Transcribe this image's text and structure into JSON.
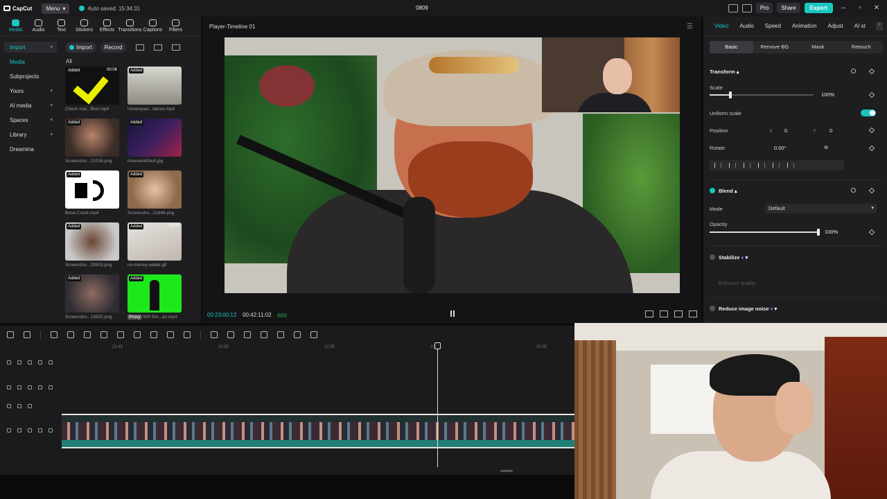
{
  "titlebar": {
    "app_name": "CapCut",
    "menu_label": "Menu",
    "autosave": "Auto saved: 15:34:31",
    "project_title": "0809",
    "pro_label": "Pro",
    "share_label": "Share",
    "export_label": "Export"
  },
  "tool_tabs": [
    "Media",
    "Audio",
    "Text",
    "Stickers",
    "Effects",
    "Transitions",
    "Captions",
    "Filters"
  ],
  "sidebar": [
    "Import",
    "Media",
    "Subprojects",
    "Yours",
    "AI media",
    "Spaces",
    "Library",
    "Dreamina"
  ],
  "media_toolbar": {
    "import": "Import",
    "record": "Record"
  },
  "media_filter": "All",
  "media_items": [
    {
      "name": "Check mar...ffect.mp4",
      "badge": "Added",
      "duration": "00:06"
    },
    {
      "name": "ishowspee...dance.mp4",
      "badge": "Added",
      "duration": ""
    },
    {
      "name": "Screensho...21028.png",
      "badge": "Added",
      "duration": ""
    },
    {
      "name": "maxresdefault.jpg",
      "badge": "Added",
      "duration": ""
    },
    {
      "name": "Bone Crack.mp4",
      "badge": "Added",
      "duration": ""
    },
    {
      "name": "Screensho...21646.png",
      "badge": "Added",
      "duration": ""
    },
    {
      "name": "Screensho...23503.png",
      "badge": "Added",
      "duration": ""
    },
    {
      "name": "no-money-wallet.gif",
      "badge": "Added",
      "duration": "00:05"
    },
    {
      "name": "Screensho...13825.png",
      "badge": "Added",
      "duration": ""
    },
    {
      "name": "Will Sm...an.mp4",
      "badge": "Added",
      "duration": "",
      "proxy": "Proxy"
    }
  ],
  "player": {
    "title": "Player-Timeline 01",
    "current_time": "00:23:00:12",
    "total_time": "00:42:11:02"
  },
  "props": {
    "tabs": [
      "Video",
      "Audio",
      "Speed",
      "Animation",
      "Adjust",
      "AI st"
    ],
    "subtabs": [
      "Basic",
      "Remove BG",
      "Mask",
      "Retouch"
    ],
    "transform_label": "Transform",
    "scale_label": "Scale",
    "scale_value": "100%",
    "scale_fraction": 0.2,
    "uniform_scale_label": "Uniform scale",
    "uniform_scale_on": true,
    "position_label": "Position",
    "pos_x_label": "X",
    "pos_x": "0",
    "pos_y_label": "Y",
    "pos_y": "0",
    "rotate_label": "Rotate",
    "rotate_value": "0.00°",
    "blend_label": "Blend",
    "mode_label": "Mode",
    "mode_value": "Default",
    "opacity_label": "Opacity",
    "opacity_value": "100%",
    "opacity_fraction": 1.0,
    "stabilize_label": "Stabilize",
    "enhance_label": "Enhance quality",
    "reduce_noise_label": "Reduce image noise"
  },
  "timeline": {
    "ruler_labels": [
      "22:45",
      "22:50",
      "22:55",
      "23:00",
      "23:05"
    ]
  },
  "colors": {
    "accent": "#18c7c0",
    "background": "#1e1e20"
  }
}
